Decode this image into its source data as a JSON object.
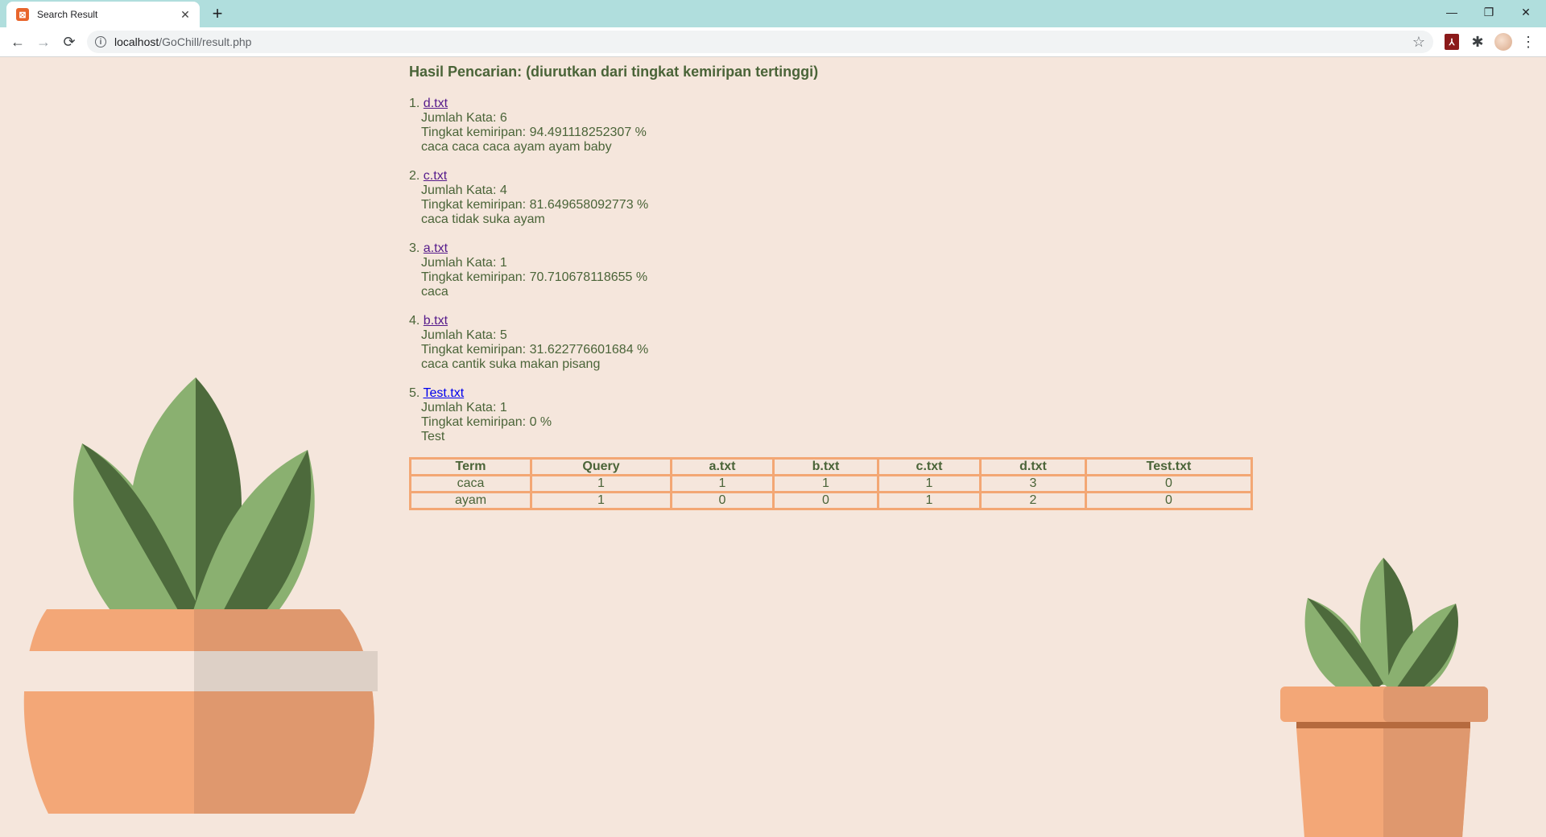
{
  "browser": {
    "tab_title": "Search Result",
    "url_host": "localhost",
    "url_path": "/GoChill/result.php"
  },
  "page": {
    "heading": "Hasil Pencarian: (diurutkan dari tingkat kemiripan tertinggi)",
    "results": [
      {
        "rank": "1.",
        "file": "d.txt",
        "jumlah": "Jumlah Kata: 6",
        "kemiripan": "Tingkat kemiripan: 94.491118252307 %",
        "content": "caca caca caca ayam ayam baby"
      },
      {
        "rank": "2.",
        "file": "c.txt",
        "jumlah": "Jumlah Kata: 4",
        "kemiripan": "Tingkat kemiripan: 81.649658092773 %",
        "content": "caca tidak suka ayam"
      },
      {
        "rank": "3.",
        "file": "a.txt",
        "jumlah": "Jumlah Kata: 1",
        "kemiripan": "Tingkat kemiripan: 70.710678118655 %",
        "content": "caca"
      },
      {
        "rank": "4.",
        "file": "b.txt",
        "jumlah": "Jumlah Kata: 5",
        "kemiripan": "Tingkat kemiripan: 31.622776601684 %",
        "content": "caca cantik suka makan pisang"
      },
      {
        "rank": "5.",
        "file": "Test.txt",
        "jumlah": "Jumlah Kata: 1",
        "kemiripan": "Tingkat kemiripan: 0 %",
        "content": "Test"
      }
    ],
    "table": {
      "headers": [
        "Term",
        "Query",
        "a.txt",
        "b.txt",
        "c.txt",
        "d.txt",
        "Test.txt"
      ],
      "rows": [
        [
          "caca",
          "1",
          "1",
          "1",
          "1",
          "3",
          "0"
        ],
        [
          "ayam",
          "1",
          "0",
          "0",
          "1",
          "2",
          "0"
        ]
      ]
    }
  },
  "colors": {
    "background": "#f5e6dc",
    "text": "#4a6438",
    "table_border": "#f3a774",
    "leaf_light": "#8ab070",
    "leaf_dark": "#4d6a3c",
    "pot_light": "#f3a777",
    "pot_dark": "#df986e"
  }
}
